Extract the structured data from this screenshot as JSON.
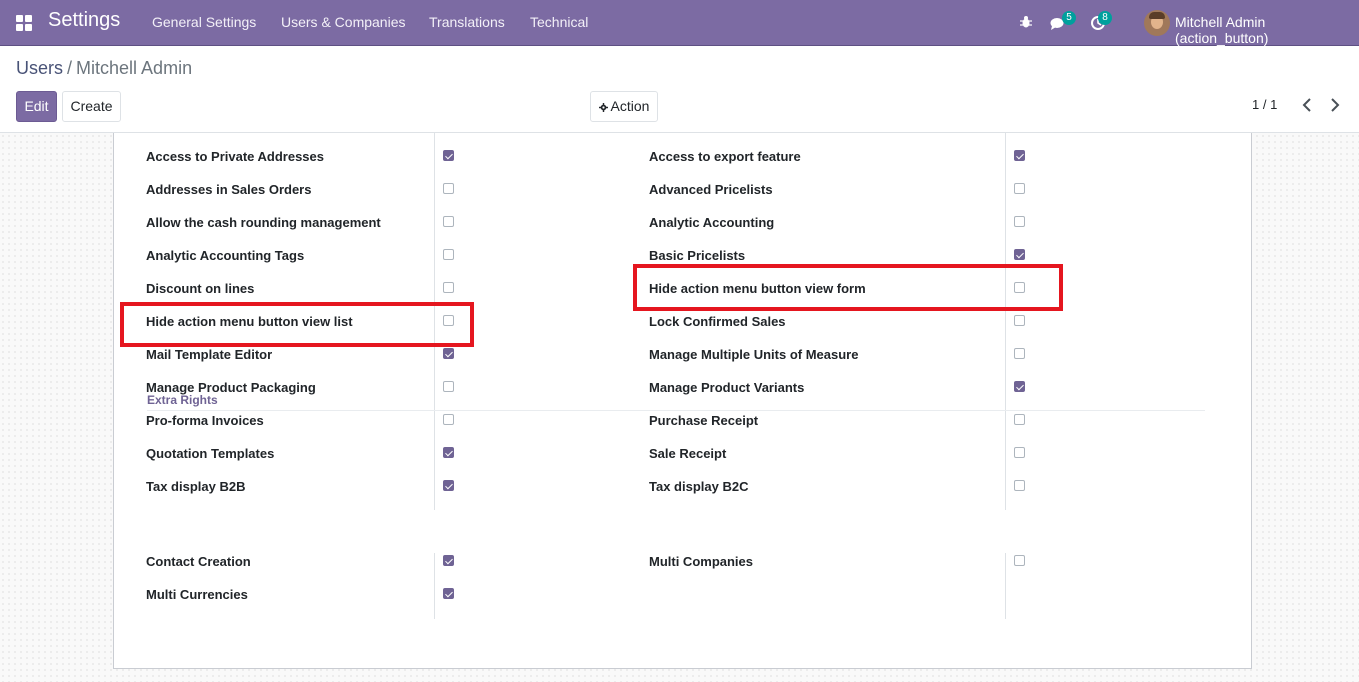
{
  "navbar": {
    "brand": "Settings",
    "menu": [
      "General Settings",
      "Users & Companies",
      "Translations",
      "Technical"
    ],
    "messages_count": "5",
    "activities_count": "8",
    "user": "Mitchell Admin (action_button)"
  },
  "breadcrumb": {
    "parent": "Users",
    "separator": "/",
    "current": "Mitchell Admin"
  },
  "buttons": {
    "edit": "Edit",
    "create": "Create",
    "action": "Action"
  },
  "pager": {
    "value": "1 / 1"
  },
  "rights": {
    "left": [
      {
        "label": "Access to Private Addresses",
        "checked": true
      },
      {
        "label": "Addresses in Sales Orders",
        "checked": false
      },
      {
        "label": "Allow the cash rounding management",
        "checked": false
      },
      {
        "label": "Analytic Accounting Tags",
        "checked": false
      },
      {
        "label": "Discount on lines",
        "checked": false
      },
      {
        "label": "Hide action menu button view list",
        "checked": false
      },
      {
        "label": "Mail Template Editor",
        "checked": true
      },
      {
        "label": "Manage Product Packaging",
        "checked": false
      },
      {
        "label": "Pro-forma Invoices",
        "checked": false
      },
      {
        "label": "Quotation Templates",
        "checked": true
      },
      {
        "label": "Tax display B2B",
        "checked": true
      }
    ],
    "right": [
      {
        "label": "Access to export feature",
        "checked": true
      },
      {
        "label": "Advanced Pricelists",
        "checked": false
      },
      {
        "label": "Analytic Accounting",
        "checked": false
      },
      {
        "label": "Basic Pricelists",
        "checked": true
      },
      {
        "label": "Hide action menu button view form",
        "checked": false
      },
      {
        "label": "Lock Confirmed Sales",
        "checked": false
      },
      {
        "label": "Manage Multiple Units of Measure",
        "checked": false
      },
      {
        "label": "Manage Product Variants",
        "checked": true
      },
      {
        "label": "Purchase Receipt",
        "checked": false
      },
      {
        "label": "Sale Receipt",
        "checked": false
      },
      {
        "label": "Tax display B2C",
        "checked": false
      }
    ]
  },
  "extra_rights": {
    "title": "Extra Rights",
    "left": [
      {
        "label": "Contact Creation",
        "checked": true
      },
      {
        "label": "Multi Currencies",
        "checked": true
      }
    ],
    "right": [
      {
        "label": "Multi Companies",
        "checked": false
      }
    ]
  },
  "colors": {
    "navbar": "#7c6ba3",
    "checked": "#6f6394",
    "highlight": "#e5161f",
    "badge": "#00a09d"
  },
  "icons": [
    "apps-icon",
    "bug-icon",
    "chat-icon",
    "activity-icon",
    "gear-icon",
    "chevron-left-icon",
    "chevron-right-icon"
  ]
}
